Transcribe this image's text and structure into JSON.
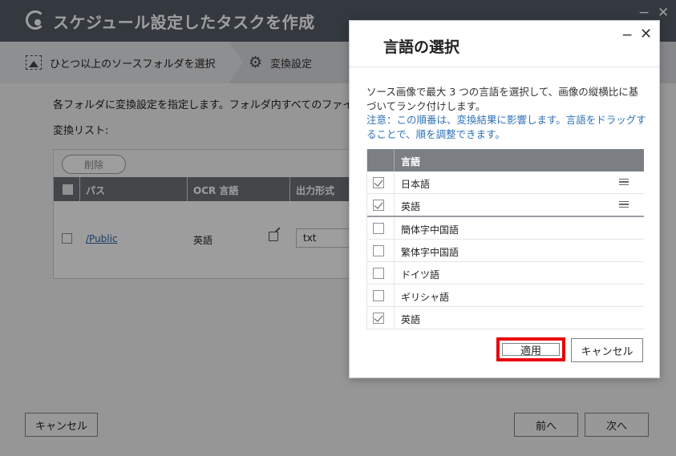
{
  "wizard": {
    "title": "スケジュール設定したタスクを作成",
    "min_glyph": "−",
    "close_glyph": "✕",
    "steps": [
      {
        "label": "ひとつ以上のソースフォルダを選択",
        "icon": "image-icon"
      },
      {
        "label": "変換設定",
        "icon": "gear-icon"
      }
    ],
    "description": "各フォルダに変換設定を指定します。フォルダ内すべてのファイ",
    "conversion_list_label": "変換リスト:",
    "delete_button": "削除",
    "table": {
      "headers": [
        "パス",
        "OCR 言語",
        "出力形式"
      ],
      "rows": [
        {
          "path": "/Public",
          "ocr_language": "英語",
          "output_format": "txt"
        }
      ]
    },
    "footer": {
      "cancel": "キャンセル",
      "prev": "前へ",
      "next": "次へ"
    }
  },
  "dialog": {
    "title": "言語の選択",
    "min_glyph": "−",
    "close_glyph": "✕",
    "description": "ソース画像で最大 3 つの言語を選択して、画像の縦横比に基づいてランク付けします。",
    "note": "注意：この順番は、変換結果に影響します。言語をドラッグすることで、順を調整できます。",
    "table_header": "言語",
    "ranked_languages": [
      {
        "label": "日本語",
        "checked": true
      },
      {
        "label": "英語",
        "checked": true
      }
    ],
    "other_languages": [
      {
        "label": "簡体字中国語",
        "checked": false
      },
      {
        "label": "繁体字中国語",
        "checked": false
      },
      {
        "label": "ドイツ語",
        "checked": false
      },
      {
        "label": "ギリシャ語",
        "checked": false
      },
      {
        "label": "英語",
        "checked": true
      }
    ],
    "apply_button": "適用",
    "cancel_button": "キャンセル",
    "highlight_color": "#e8000b"
  }
}
